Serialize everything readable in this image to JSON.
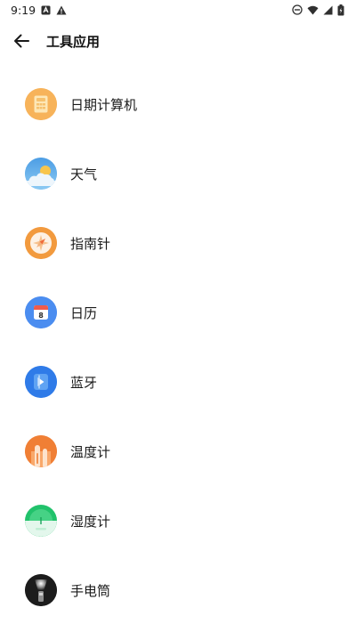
{
  "status_bar": {
    "time": "9:19",
    "left_icons": [
      "notification-a-icon",
      "warning-icon"
    ],
    "right_icons": [
      "do-not-disturb-icon",
      "wifi-icon",
      "signal-icon",
      "battery-icon"
    ]
  },
  "app_bar": {
    "back_icon": "arrow-back-icon",
    "title": "工具应用"
  },
  "tools": [
    {
      "label": "日期计算机",
      "icon": "date-calculator-icon"
    },
    {
      "label": "天气",
      "icon": "weather-icon"
    },
    {
      "label": "指南针",
      "icon": "compass-icon"
    },
    {
      "label": "日历",
      "icon": "calendar-icon",
      "icon_text": "8"
    },
    {
      "label": "蓝牙",
      "icon": "bluetooth-icon"
    },
    {
      "label": "温度计",
      "icon": "thermometer-icon"
    },
    {
      "label": "湿度计",
      "icon": "hygrometer-icon"
    },
    {
      "label": "手电筒",
      "icon": "flashlight-icon"
    }
  ],
  "colors": {
    "date_calculator": "#f6a94b",
    "weather": "#5aa9e6",
    "compass": "#f29a3e",
    "calendar": "#4b8df0",
    "bluetooth": "#2f7be8",
    "thermometer": "#f07f35",
    "hygrometer": "#21c26b",
    "flashlight": "#1c1c1c"
  }
}
